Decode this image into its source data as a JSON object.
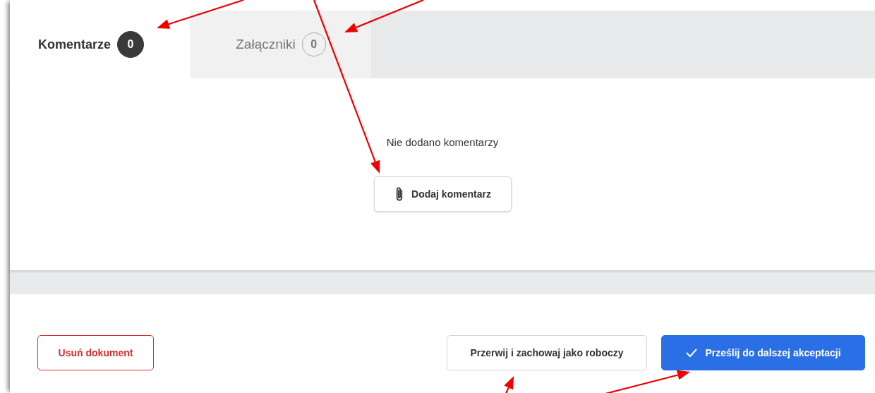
{
  "tabs": [
    {
      "label": "Komentarze",
      "count": "0",
      "selected": true
    },
    {
      "label": "Załączniki",
      "count": "0",
      "selected": false
    }
  ],
  "comments": {
    "empty_message": "Nie dodano komentarzy",
    "add_button": "Dodaj komentarz"
  },
  "footer": {
    "buttons": [
      {
        "kind": "danger",
        "label": "Usuń dokument"
      },
      {
        "kind": "secondary",
        "label": "Przerwij i zachowaj jako roboczy"
      },
      {
        "kind": "primary",
        "label": "Prześlij do dalszej akceptacji"
      }
    ]
  }
}
